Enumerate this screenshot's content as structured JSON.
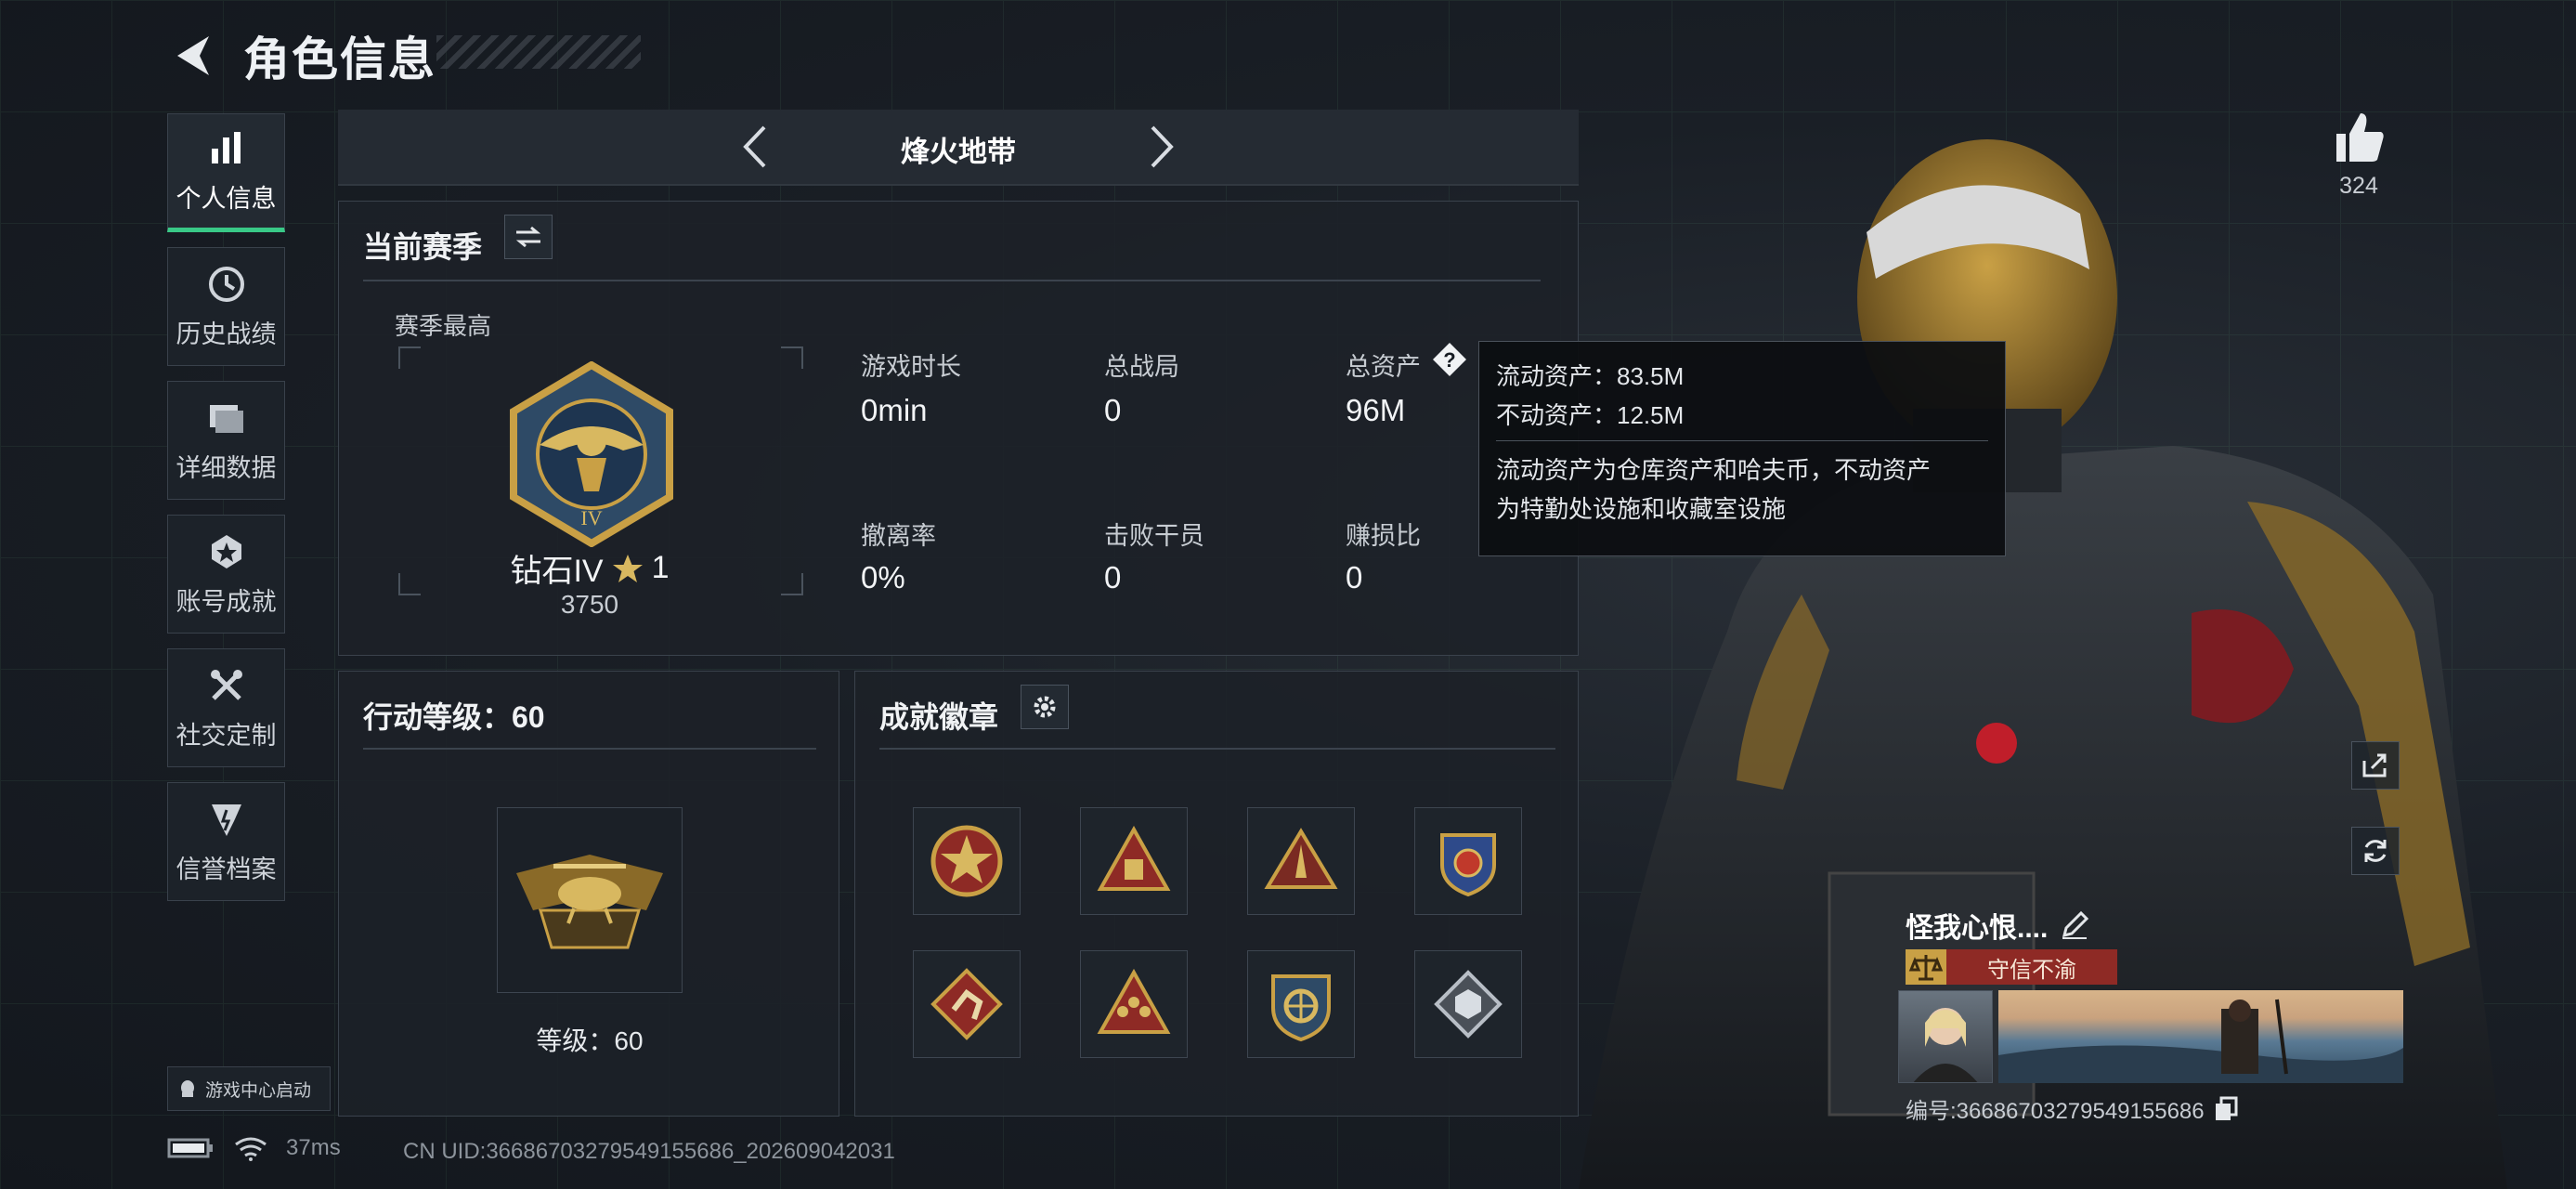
{
  "header": {
    "title": "角色信息"
  },
  "sidebar": {
    "items": [
      {
        "label": "个人信息",
        "icon": "bar-chart-icon",
        "active": true
      },
      {
        "label": "历史战绩",
        "icon": "clock-icon"
      },
      {
        "label": "详细数据",
        "icon": "folder-icon"
      },
      {
        "label": "账号成就",
        "icon": "medal-icon"
      },
      {
        "label": "社交定制",
        "icon": "tools-icon"
      },
      {
        "label": "信誉档案",
        "icon": "shield-icon"
      }
    ],
    "launch_label": "游戏中心启动"
  },
  "mode_bar": {
    "current": "烽火地带"
  },
  "season_panel": {
    "title": "当前赛季",
    "best_label": "赛季最高",
    "rank_name": "钻石IV",
    "rank_stars": "1",
    "rank_points": "3750",
    "stats": [
      {
        "label": "游戏时长",
        "value": "0min"
      },
      {
        "label": "总战局",
        "value": "0"
      },
      {
        "label": "总资产",
        "value": "96M"
      },
      {
        "label": "撤离率",
        "value": "0%"
      },
      {
        "label": "击败干员",
        "value": "0"
      },
      {
        "label": "赚损比",
        "value": "0"
      }
    ]
  },
  "tooltip": {
    "liquid": "流动资产：83.5M",
    "fixed": "不动资产：12.5M",
    "desc_line1": "流动资产为仓库资产和哈夫币，不动资产",
    "desc_line2": "为特勤处设施和收藏室设施"
  },
  "action_panel": {
    "title": "行动等级：60",
    "level_text": "等级：60"
  },
  "achievement_panel": {
    "title": "成就徽章",
    "badges": [
      "badge-star-icon",
      "badge-triangle-icon",
      "badge-rocket-icon",
      "badge-shield-icon",
      "badge-kick-icon",
      "badge-squad-icon",
      "badge-target-icon",
      "badge-cube-icon"
    ]
  },
  "status_bar": {
    "ping": "37ms",
    "uid": "CN UID:36686703279549155686_202609042031"
  },
  "profile": {
    "likes": "324",
    "nickname": "怪我心恨....",
    "title_tag": "守信不渝",
    "id_text": "编号:36686703279549155686"
  },
  "colors": {
    "accent_green": "#39c987",
    "gold": "#c9a045",
    "tag_red": "#8e2a25"
  }
}
